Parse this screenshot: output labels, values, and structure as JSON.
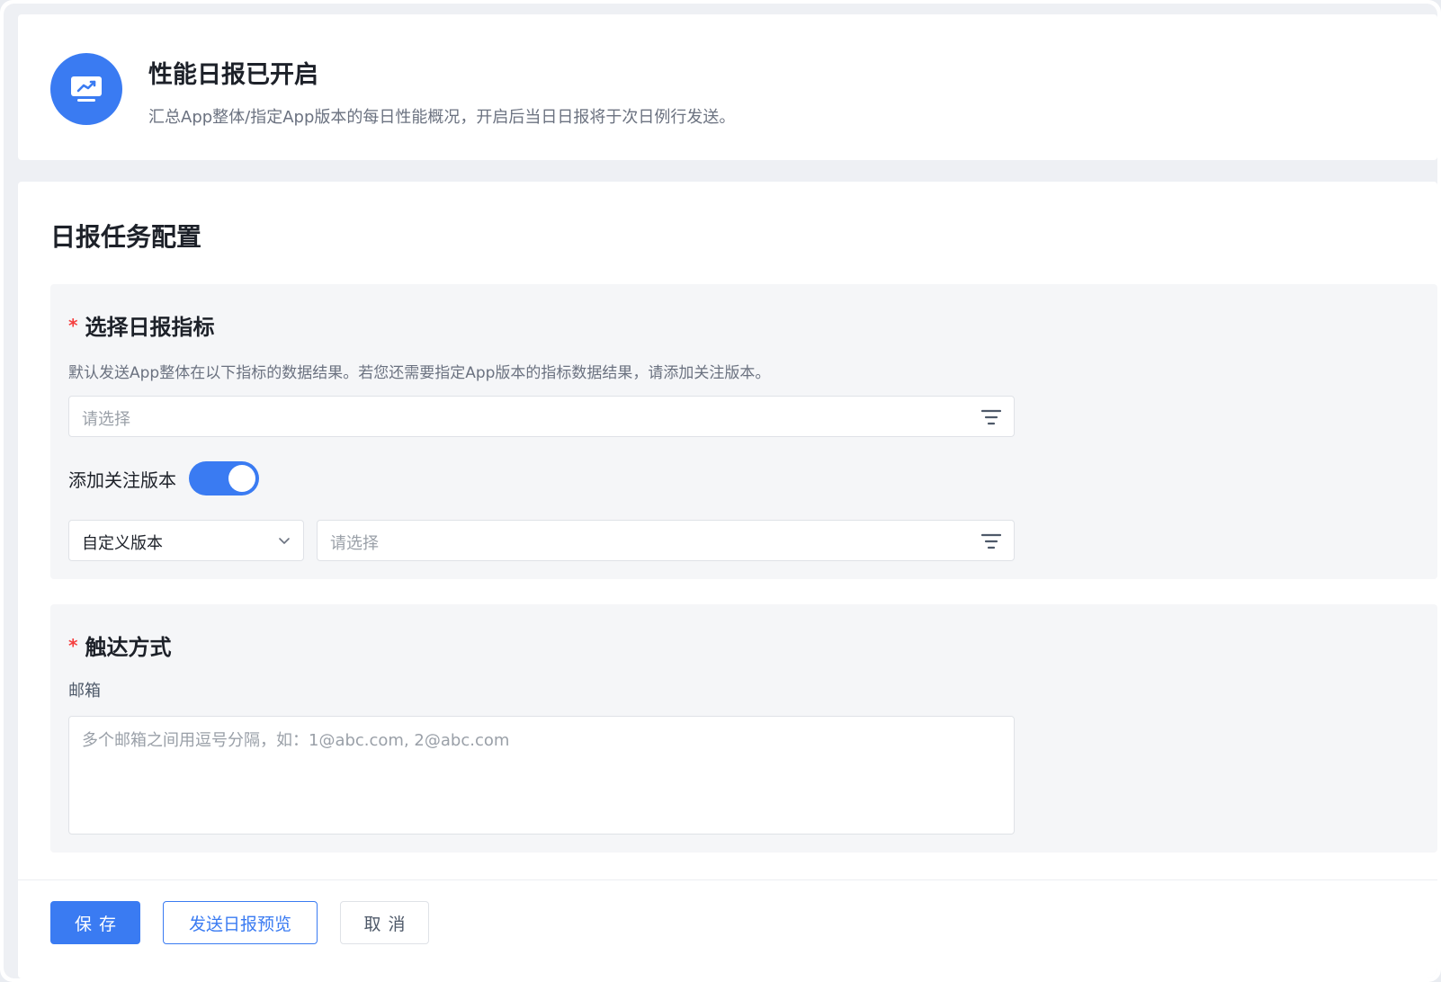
{
  "header": {
    "title": "性能日报已开启",
    "description": "汇总App整体/指定App版本的每日性能概况，开启后当日日报将于次日例行发送。",
    "icon": "monitor-trend-icon",
    "accent_color": "#3a7bf2"
  },
  "config": {
    "title": "日报任务配置",
    "metrics_section": {
      "required_mark": "*",
      "title": "选择日报指标",
      "description": "默认发送App整体在以下指标的数据结果。若您还需要指定App版本的指标数据结果，请添加关注版本。",
      "metric_select_placeholder": "请选择",
      "toggle_label": "添加关注版本",
      "toggle_on": true,
      "version_type_value": "自定义版本",
      "version_select_placeholder": "请选择"
    },
    "reach_section": {
      "required_mark": "*",
      "title": "触达方式",
      "email_label": "邮箱",
      "email_placeholder": "多个邮箱之间用逗号分隔，如：1@abc.com, 2@abc.com"
    }
  },
  "footer": {
    "save_label": "保存",
    "preview_label": "发送日报预览",
    "cancel_label": "取消"
  }
}
